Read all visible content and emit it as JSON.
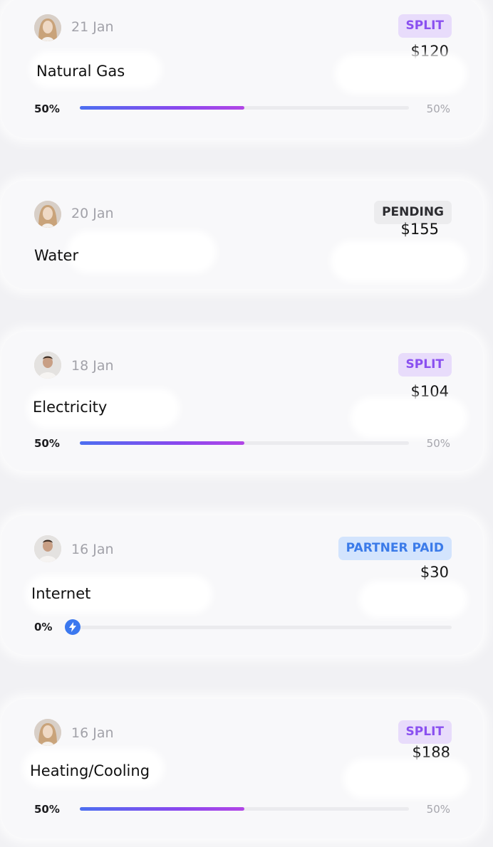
{
  "transactions": [
    {
      "date": "21 Jan",
      "status": "SPLIT",
      "status_color": "#8a50f0",
      "amount": "$120",
      "title": "Natural Gas",
      "avatar": "woman-avatar",
      "progress": {
        "left_label": "50%",
        "right_label": "50%",
        "value": 0.5
      }
    },
    {
      "date": "20 Jan",
      "status": "PENDING",
      "status_color": "#2c2c30",
      "amount": "$155",
      "title": "Water",
      "avatar": "woman-avatar"
    },
    {
      "date": "18 Jan",
      "status": "SPLIT",
      "status_color": "#8a50f0",
      "amount": "$104",
      "title": "Electricity",
      "avatar": "man-avatar",
      "progress": {
        "left_label": "50%",
        "right_label": "50%",
        "value": 0.5
      }
    },
    {
      "date": "16 Jan",
      "status": "PARTNER PAID",
      "status_color": "#3b7be9",
      "amount": "$30",
      "title": "Internet",
      "avatar": "man-avatar",
      "progress": {
        "left_label": "0%",
        "value": 0.0,
        "icon": "lightning-icon"
      }
    },
    {
      "date": "16 Jan",
      "status": "SPLIT",
      "status_color": "#8a50f0",
      "amount": "$188",
      "title": "Heating/Cooling",
      "avatar": "woman-avatar",
      "progress": {
        "left_label": "50%",
        "right_label": "50%",
        "value": 0.5
      }
    }
  ]
}
